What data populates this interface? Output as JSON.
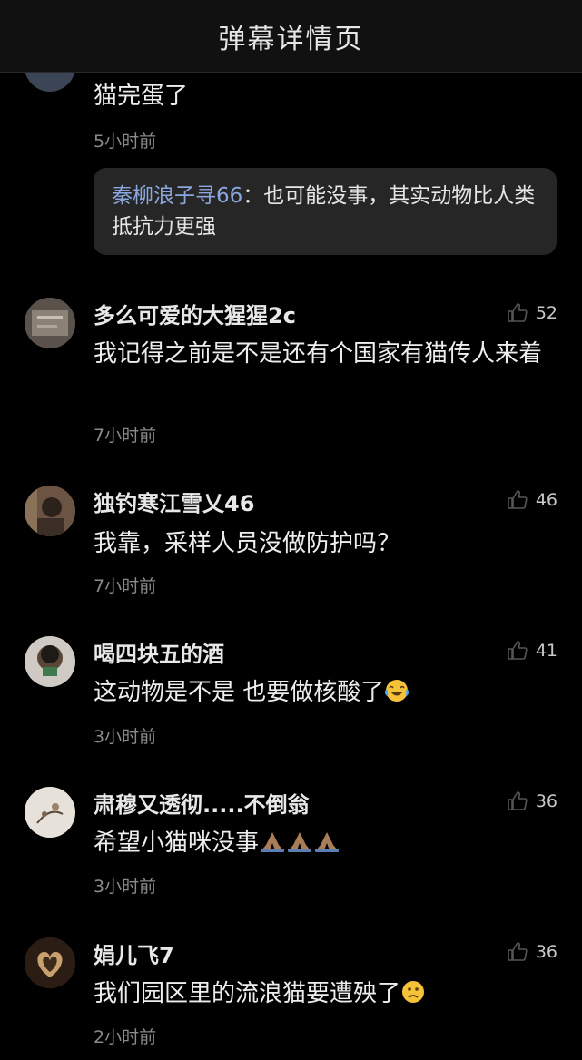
{
  "header": {
    "title": "弹幕详情页"
  },
  "top_comment": {
    "text": "猫完蛋了",
    "time": "5小时前",
    "reply": {
      "user": "秦柳浪子寻66",
      "sep": "：",
      "text": "也可能没事，其实动物比人类抵抗力更强"
    }
  },
  "comments": [
    {
      "user": "多么可爱的大猩猩2c",
      "text": "我记得之前是不是还有个国家有猫传人来着",
      "time": "7小时前",
      "likes": "52"
    },
    {
      "user": "独钓寒江雪乂46",
      "text": "我靠，采样人员没做防护吗？",
      "time": "7小时前",
      "likes": "46"
    },
    {
      "user": "喝四块五的酒",
      "text": "这动物是不是 也要做核酸了",
      "time": "3小时前",
      "likes": "41",
      "emoji": "laughing-crying"
    },
    {
      "user": "肃穆又透彻.....不倒翁",
      "text": "希望小猫咪没事",
      "time": "3小时前",
      "likes": "36",
      "emoji": "folded-hands"
    },
    {
      "user": "娟儿飞7",
      "text": "我们园区里的流浪猫要遭殃了",
      "time": "2小时前",
      "likes": "36",
      "emoji": "slightly-frowning"
    }
  ]
}
